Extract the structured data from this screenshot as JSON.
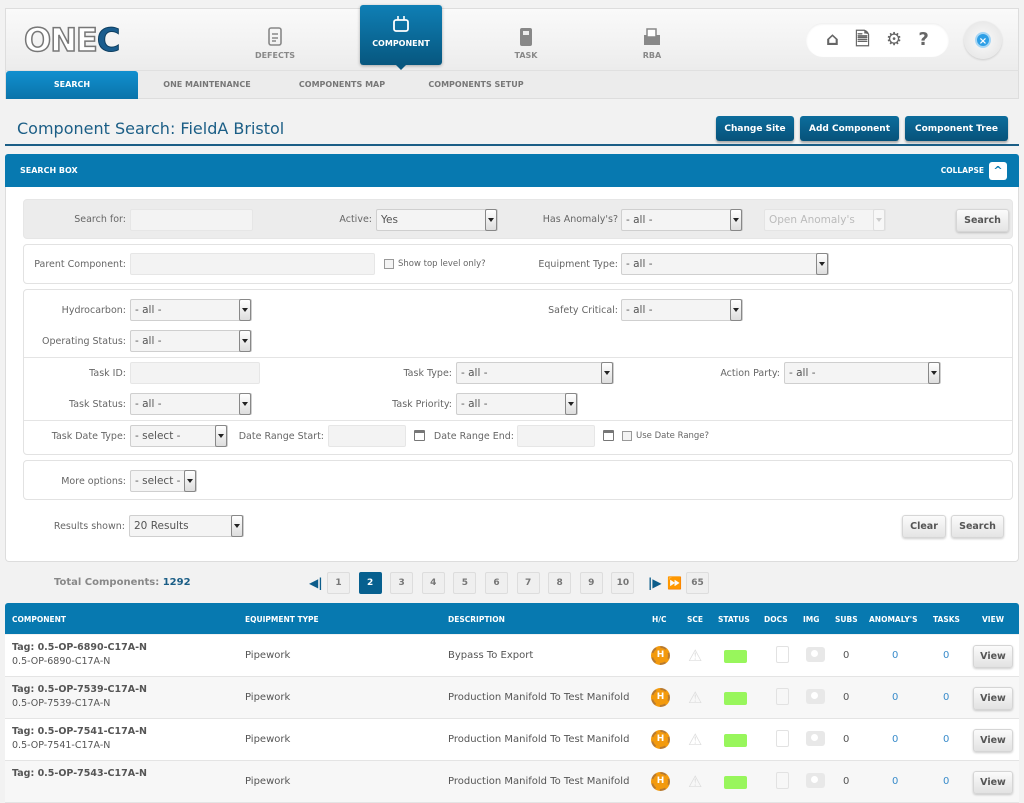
{
  "header": {
    "logo": "ONE",
    "nav": [
      {
        "label": "DEFECTS",
        "icon": "defects-icon"
      },
      {
        "label": "COMPONENT",
        "icon": "component-icon",
        "active": true
      },
      {
        "label": "TASK",
        "icon": "task-icon"
      },
      {
        "label": "RBA",
        "icon": "rba-icon"
      }
    ],
    "utility_icons": [
      "home-icon",
      "settings-doc-icon",
      "gears-icon",
      "help-icon"
    ],
    "help_glyph": "?",
    "close_glyph": "×"
  },
  "subnav": [
    {
      "label": "SEARCH",
      "active": true
    },
    {
      "label": "ONE MAINTENANCE"
    },
    {
      "label": "COMPONENTS MAP"
    },
    {
      "label": "COMPONENTS SETUP"
    }
  ],
  "page": {
    "title": "Component Search: FieldA Bristol",
    "buttons": {
      "change_site": "Change Site",
      "add_component": "Add Component",
      "component_tree": "Component Tree"
    }
  },
  "search_box": {
    "title": "SEARCH BOX",
    "collapse": "COLLAPSE",
    "collapse_glyph": "^",
    "search_for": {
      "label": "Search for:",
      "value": ""
    },
    "active": {
      "label": "Active:",
      "value": "Yes"
    },
    "has_anomaly": {
      "label": "Has Anomaly's?",
      "value": "- all -"
    },
    "open_anomaly": {
      "value": "Open Anomaly's"
    },
    "search_button": "Search",
    "parent_component": {
      "label": "Parent Component:",
      "value": ""
    },
    "show_top_level": {
      "label": "Show top level only?",
      "checked": false
    },
    "equipment_type": {
      "label": "Equipment Type:",
      "value": "- all -"
    },
    "hydrocarbon": {
      "label": "Hydrocarbon:",
      "value": "- all -"
    },
    "safety_critical": {
      "label": "Safety Critical:",
      "value": "- all -"
    },
    "operating_status": {
      "label": "Operating Status:",
      "value": "- all -"
    },
    "task_id": {
      "label": "Task ID:",
      "value": ""
    },
    "task_type": {
      "label": "Task Type:",
      "value": "- all -"
    },
    "action_party": {
      "label": "Action Party:",
      "value": "- all -"
    },
    "task_status": {
      "label": "Task Status:",
      "value": "- all -"
    },
    "task_priority": {
      "label": "Task Priority:",
      "value": "- all -"
    },
    "task_date_type": {
      "label": "Task Date Type:",
      "value": "- select -"
    },
    "date_range_start": {
      "label": "Date Range Start:",
      "value": ""
    },
    "date_range_end": {
      "label": "Date Range End:",
      "value": ""
    },
    "use_date_range": {
      "label": "Use Date Range?",
      "checked": false
    },
    "more_options": {
      "label": "More options:",
      "value": "- select -"
    },
    "results_shown": {
      "label": "Results shown:",
      "value": "20 Results"
    },
    "clear_button": "Clear",
    "search_button_bottom": "Search"
  },
  "pagination": {
    "total_label": "Total Components:",
    "total_value": "1292",
    "pages": [
      "1",
      "2",
      "3",
      "4",
      "5",
      "6",
      "7",
      "8",
      "9",
      "10"
    ],
    "current": "2",
    "last": "65"
  },
  "table": {
    "columns": [
      "COMPONENT",
      "EQUIPMENT TYPE",
      "DESCRIPTION",
      "H/C",
      "SCE",
      "STATUS",
      "DOCS",
      "IMG",
      "SUBS",
      "ANOMALY'S",
      "TASKS",
      "VIEW"
    ],
    "rows": [
      {
        "tag": "Tag: 0.5-OP-6890-C17A-N",
        "name": "0.5-OP-6890-C17A-N",
        "equipment_type": "Pipework",
        "description": "Bypass To Export",
        "hc": "H",
        "status_color": "#98f65c",
        "subs": "0",
        "anomalies": "0",
        "tasks": "0",
        "view": "View"
      },
      {
        "tag": "Tag: 0.5-OP-7539-C17A-N",
        "name": "0.5-OP-7539-C17A-N",
        "equipment_type": "Pipework",
        "description": "Production Manifold To Test Manifold",
        "hc": "H",
        "status_color": "#98f65c",
        "subs": "0",
        "anomalies": "0",
        "tasks": "0",
        "view": "View"
      },
      {
        "tag": "Tag: 0.5-OP-7541-C17A-N",
        "name": "0.5-OP-7541-C17A-N",
        "equipment_type": "Pipework",
        "description": "Production Manifold To Test Manifold",
        "hc": "H",
        "status_color": "#98f65c",
        "subs": "0",
        "anomalies": "0",
        "tasks": "0",
        "view": "View"
      },
      {
        "tag": "Tag: 0.5-OP-7543-C17A-N",
        "name": "",
        "equipment_type": "Pipework",
        "description": "Production Manifold To Test Manifold",
        "hc": "H",
        "status_color": "#98f65c",
        "subs": "0",
        "anomalies": "0",
        "tasks": "0",
        "view": "View"
      }
    ]
  }
}
